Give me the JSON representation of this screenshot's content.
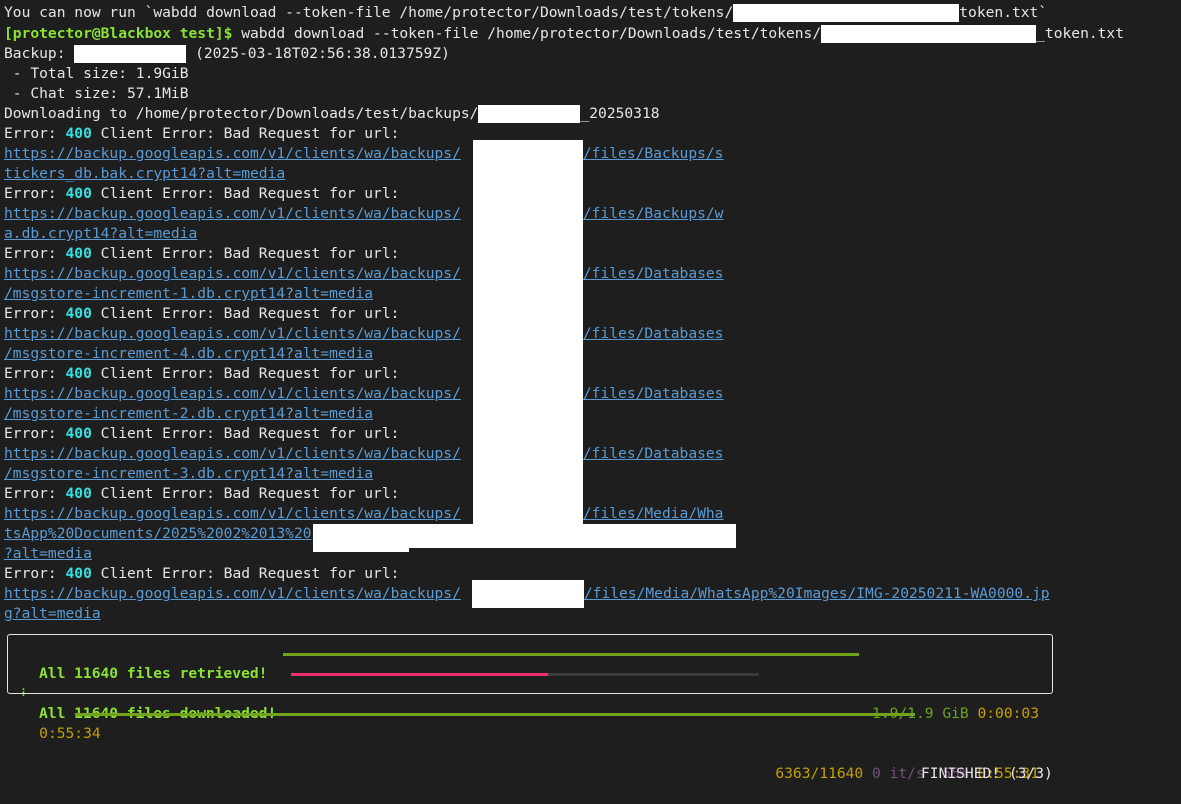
{
  "terminal": {
    "line1": {
      "before": "You can now run `wabdd download --token-file /home/protector/Downloads/test/tokens/",
      "after": "token.txt`"
    },
    "line2": {
      "prompt": "[protector@Blackbox test]$",
      "before": " wabdd download --token-file /home/protector/Downloads/test/tokens/",
      "after": "_token.txt"
    },
    "backup": {
      "label": "Backup: ",
      "timestamp": " (2025-03-18T02:56:38.013759Z)"
    },
    "total_size": " - Total size: 1.9GiB",
    "chat_size": " - Chat size: 57.1MiB",
    "downloading": {
      "before": "Downloading to /home/protector/Downloads/test/backups/",
      "after": "_20250318"
    },
    "error": {
      "prefix": "Error: ",
      "code": "400",
      "suffix": " Client Error: Bad Request for url:"
    },
    "url_prefix": "https://backup.googleapis.com/v1/clients/wa/backups/",
    "errors": [
      {
        "tail1": "/files/Backups/s",
        "line2": "tickers_db.bak.crypt14?alt=media"
      },
      {
        "tail1": "/files/Backups/w",
        "line2": "a.db.crypt14?alt=media"
      },
      {
        "tail1": "/files/Databases",
        "line2": "/msgstore-increment-1.db.crypt14?alt=media"
      },
      {
        "tail1": "/files/Databases",
        "line2": "/msgstore-increment-4.db.crypt14?alt=media"
      },
      {
        "tail1": "/files/Databases",
        "line2": "/msgstore-increment-2.db.crypt14?alt=media"
      },
      {
        "tail1": "/files/Databases",
        "line2": "/msgstore-increment-3.db.crypt14?alt=media"
      },
      {
        "tail1": "/files/Media/Wha",
        "line2": "tsApp%20Documents/2025%2002%2013%20",
        "line3": "?alt=media"
      },
      {
        "tail1": "/files/Media/WhatsApp%20Images/IMG-20250211-WA0000.jp",
        "line2": "g?alt=media"
      }
    ]
  },
  "progress": {
    "retrieved": {
      "label": "All 11640 files retrieved!",
      "size": "1.9/1.9 GiB",
      "time": "0:00:03",
      "fraction": 1.0,
      "color": "#73a31c"
    },
    "downloaded": {
      "spinner": "⠇",
      "label": "All 11640 files downloaded!",
      "count": "6363/11640",
      "rate": "0 it/s",
      "percent": "55%",
      "time": "0:55:31",
      "fraction": 0.55,
      "color": "#f0306c"
    },
    "overall": {
      "elapsed": "0:55:34",
      "status": "FINISHED! (3/3)",
      "fraction": 1.0
    }
  }
}
